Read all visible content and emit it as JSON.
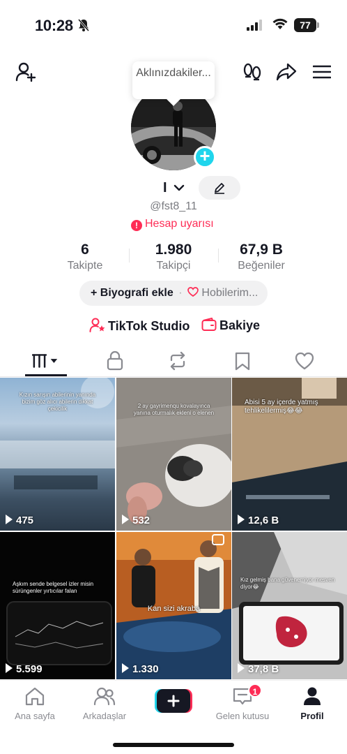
{
  "status": {
    "time": "10:28",
    "battery": "77"
  },
  "tooltip": {
    "text": "Aklınızdakiler..."
  },
  "profile": {
    "display_name": "I",
    "username": "@fst8_11",
    "warning": "Hesap uyarısı"
  },
  "stats": [
    {
      "value": "6",
      "label": "Takipte"
    },
    {
      "value": "1.980",
      "label": "Takipçi"
    },
    {
      "value": "67,9 B",
      "label": "Beğeniler"
    }
  ],
  "bio": {
    "add": "Biyografi ekle",
    "hobbies": "Hobilerim..."
  },
  "links": {
    "studio": "TikTok Studio",
    "balance": "Bakiye"
  },
  "videos": [
    {
      "views": "475",
      "caption": "Kızın sarışın abilerinin yanında bizim göz alıcı abilerin dikkat çekicilik"
    },
    {
      "views": "532",
      "caption": "2 ay gayrimenqu kovalayınca yanına oturmalık ekleni o elenen"
    },
    {
      "views": "12,6 B",
      "caption": "Abisi 5 ay içerde yatmış tehlikelilermiş😂😂"
    },
    {
      "views": "5.599",
      "caption": "Aşkım sende belgesel izler misin sürüngenler yırtıcılar falan"
    },
    {
      "views": "1.330",
      "caption": "Kan sizi akraba"
    },
    {
      "views": "37,8 B",
      "caption": "Kız gelmiş bana güvenemiyor mesven diyor😂"
    }
  ],
  "nav": {
    "home": "Ana sayfa",
    "friends": "Arkadaşlar",
    "inbox": "Gelen kutusu",
    "inbox_badge": "1",
    "profile": "Profil"
  },
  "colors": {
    "accent": "#fe2c55",
    "cyan": "#20d5ec",
    "text": "#161823",
    "muted": "#7a7b80"
  }
}
